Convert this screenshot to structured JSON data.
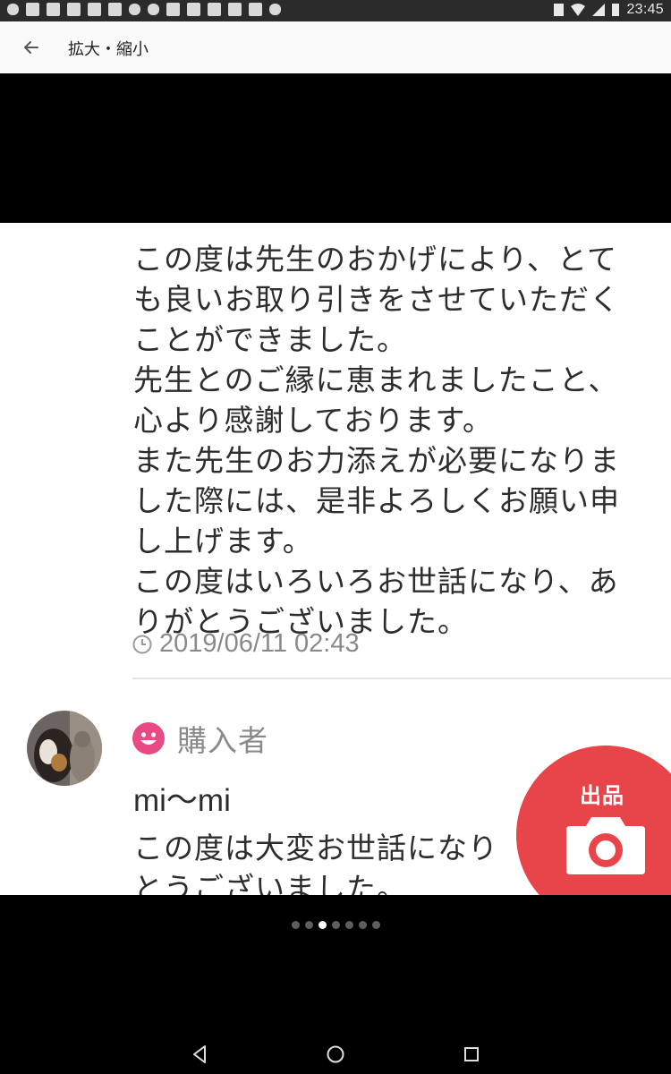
{
  "status_bar": {
    "time": "23:45",
    "left_icons": [
      "nfc-icon",
      "cube-icon",
      "gmail-icon",
      "gmail-icon",
      "gmail-icon",
      "image-icon",
      "talk-icon",
      "cloud-icon",
      "warning-icon",
      "calendar-icon",
      "calendar-icon",
      "d-icon",
      "twitter-icon",
      "play-icon"
    ],
    "right_icons": [
      "bluetooth-icon",
      "wifi-icon",
      "signal-icon",
      "battery-icon"
    ]
  },
  "app_bar": {
    "title": "拡大・縮小"
  },
  "post": {
    "message_lines": [
      "この度は先生のおかげにより、とて",
      "も良いお取り引きをさせていただく",
      "ことができました。",
      "先生とのご縁に恵まれましたこと、",
      "心より感謝しております。",
      "また先生のお力添えが必要になりま",
      "した際には、是非よろしくお願い申",
      "し上げます。",
      "この度はいろいろお世話になり、あ",
      "りがとうございました。"
    ],
    "timestamp": "2019/06/11 02:43"
  },
  "reply": {
    "role": "購入者",
    "username": "mi〜mi",
    "message_lines": [
      "この度は大変お世話になり",
      "とうございました。"
    ]
  },
  "fab": {
    "label": "出品",
    "color": "#e8454b"
  },
  "pager": {
    "count": 7,
    "active_index": 2
  }
}
